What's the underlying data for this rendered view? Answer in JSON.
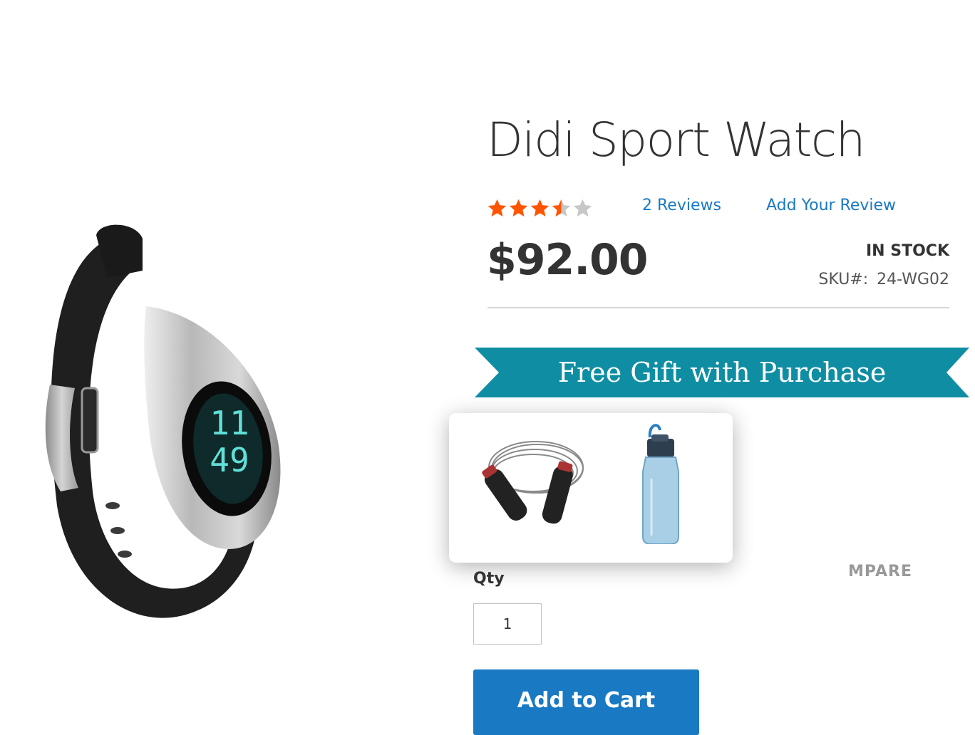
{
  "product": {
    "name": "Didi Sport Watch",
    "price": "$92.00",
    "stock_status": "IN STOCK",
    "sku_label": "SKU#:",
    "sku_value": "24-WG02",
    "rating_stars": 3.5,
    "rating_max": 5,
    "image_display": {
      "hours": "11",
      "minutes": "49"
    }
  },
  "reviews": {
    "count_label": "2 Reviews",
    "add_label": "Add Your Review"
  },
  "promo": {
    "banner_text": "Free Gift with Purchase",
    "gifts": [
      {
        "icon": "jump-rope-icon"
      },
      {
        "icon": "water-bottle-icon"
      }
    ]
  },
  "purchase": {
    "compare_label": "MPARE",
    "qty_label": "Qty",
    "qty_value": "1",
    "add_to_cart_label": "Add to Cart"
  },
  "colors": {
    "link": "#1979c3",
    "button": "#1979c3",
    "star_filled": "#ff5501",
    "star_empty": "#c7c7c7",
    "ribbon": "#0f8ea3",
    "ribbon_dark": "#0a6f80"
  }
}
